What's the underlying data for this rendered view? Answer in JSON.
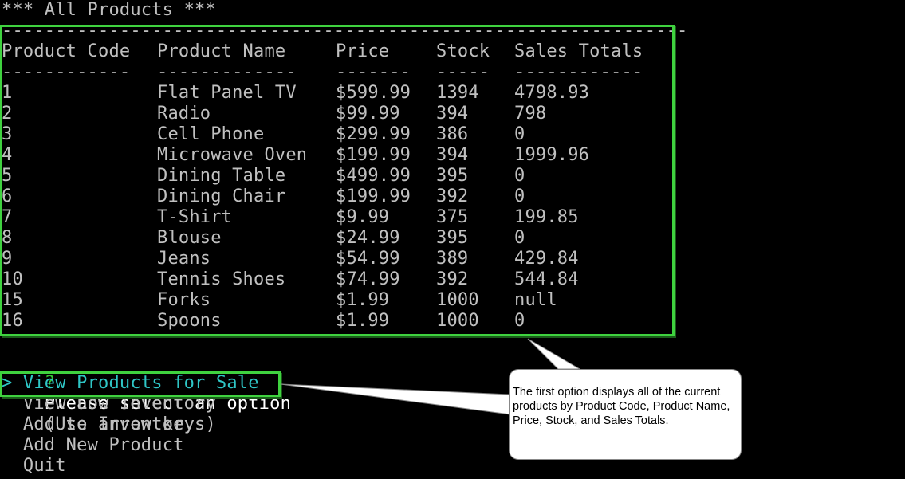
{
  "title": "*** All Products ***",
  "divider": "----------------------------------------------------------------",
  "table": {
    "headers": [
      "Product Code",
      "Product Name",
      "Price",
      "Stock",
      "Sales Totals"
    ],
    "underlines": [
      "------------",
      "-------------",
      "-------",
      "-----",
      "------------"
    ],
    "rows": [
      [
        "1",
        "Flat Panel TV",
        "$599.99",
        "1394",
        "4798.93"
      ],
      [
        "2",
        "Radio",
        "$99.99",
        "394",
        "798"
      ],
      [
        "3",
        "Cell Phone",
        "$299.99",
        "386",
        "0"
      ],
      [
        "4",
        "Microwave Oven",
        "$199.99",
        "394",
        "1999.96"
      ],
      [
        "5",
        "Dining Table",
        "$499.99",
        "395",
        "0"
      ],
      [
        "6",
        "Dining Chair",
        "$199.99",
        "392",
        "0"
      ],
      [
        "7",
        "T-Shirt",
        "$9.99",
        "375",
        "199.85"
      ],
      [
        "8",
        "Blouse",
        "$24.99",
        "395",
        "0"
      ],
      [
        "9",
        "Jeans",
        "$54.99",
        "389",
        "429.84"
      ],
      [
        "10",
        "Tennis Shoes",
        "$74.99",
        "392",
        "544.84"
      ],
      [
        "15",
        "Forks",
        "$1.99",
        "1000",
        "null"
      ],
      [
        "16",
        "Spoons",
        "$1.99",
        "1000",
        "0"
      ]
    ]
  },
  "prompt": {
    "marker": "?",
    "question": "Please select an option",
    "hint": "(Use arrow keys)"
  },
  "menu": {
    "pointer": ">",
    "options": [
      "View Products for Sale",
      "View Low Inventory",
      "Add to Inventory",
      "Add New Product",
      "Quit"
    ],
    "selected_index": 0
  },
  "callout": {
    "text": "The first option displays all of the current products by Product Code, Product Name, Price, Stock, and Sales Totals."
  },
  "colors": {
    "background": "#000000",
    "text": "#c0c0c0",
    "highlight_box": "#3fd23f",
    "selected_option": "#2fc6c6",
    "prompt_marker": "#34c634"
  }
}
